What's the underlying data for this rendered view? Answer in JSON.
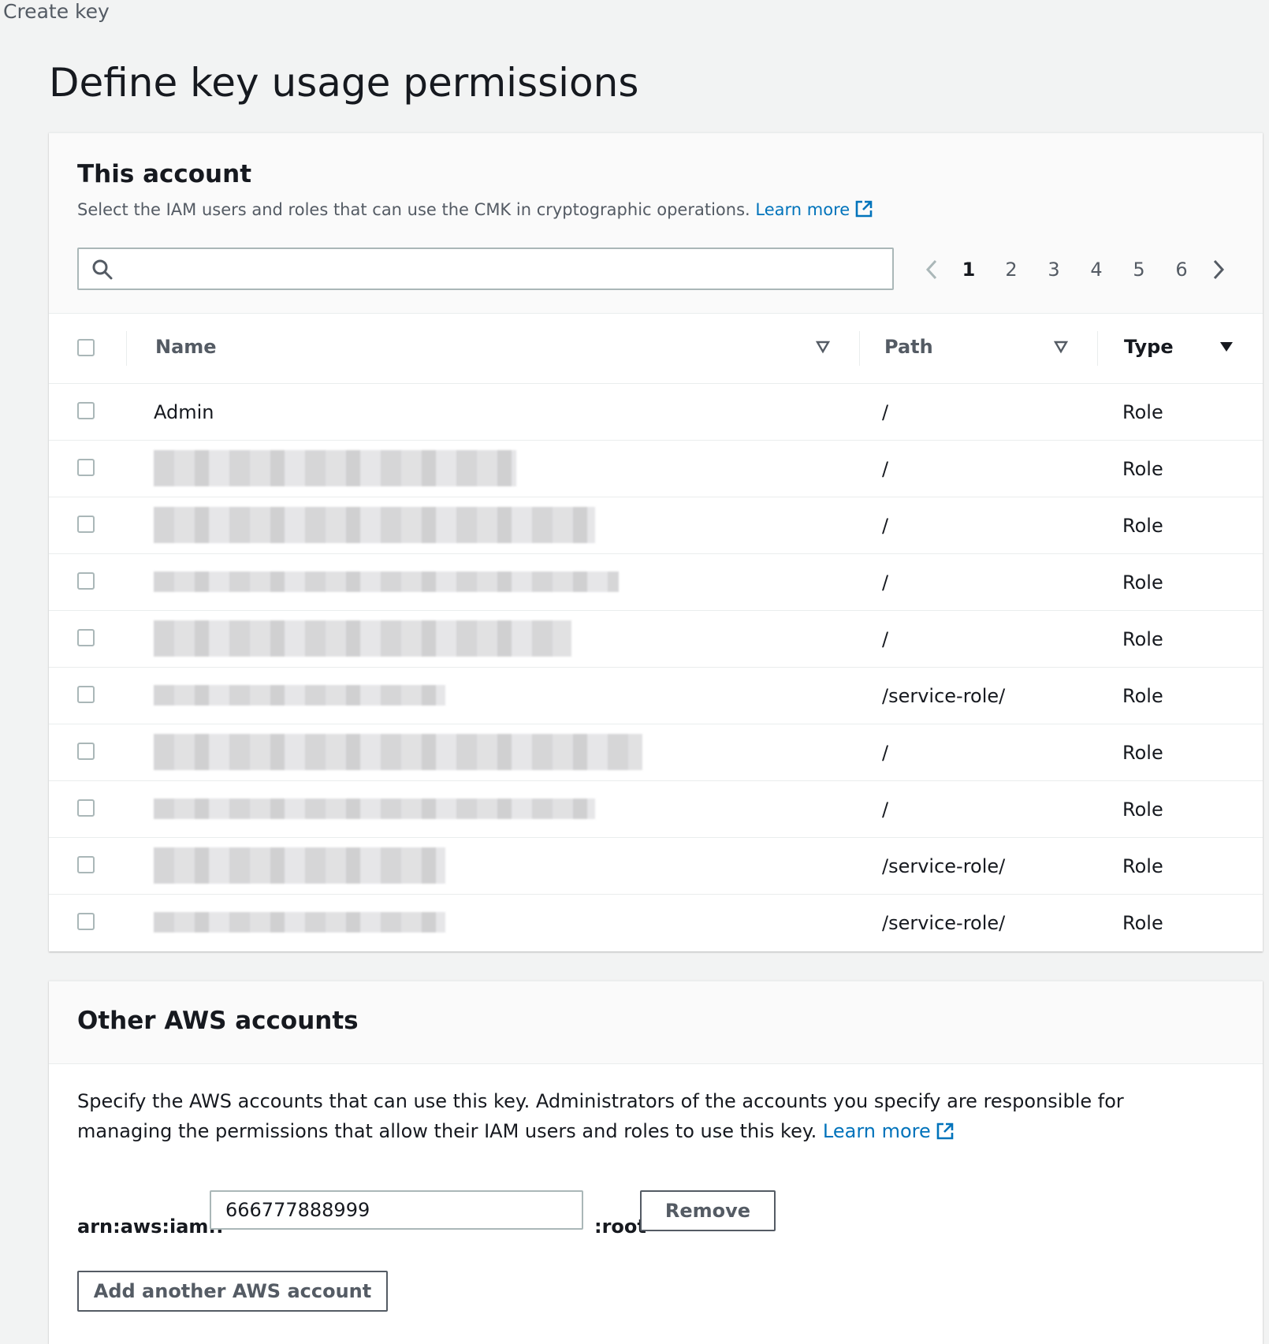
{
  "breadcrumb": "Create key",
  "page_title": "Define key usage permissions",
  "this_account": {
    "title": "This account",
    "description": "Select the IAM users and roles that can use the CMK in cryptographic operations.",
    "learn_more": "Learn more",
    "search_placeholder": "",
    "pagination": {
      "pages": [
        "1",
        "2",
        "3",
        "4",
        "5",
        "6"
      ],
      "current": "1"
    },
    "columns": {
      "name": "Name",
      "path": "Path",
      "type": "Type"
    },
    "rows": [
      {
        "name": "Admin",
        "path": "/",
        "type": "Role"
      },
      {
        "name": "",
        "path": "/",
        "type": "Role"
      },
      {
        "name": "",
        "path": "/",
        "type": "Role"
      },
      {
        "name": "",
        "path": "/",
        "type": "Role"
      },
      {
        "name": "",
        "path": "/",
        "type": "Role"
      },
      {
        "name": "",
        "path": "/service-role/",
        "type": "Role"
      },
      {
        "name": "",
        "path": "/",
        "type": "Role"
      },
      {
        "name": "",
        "path": "/",
        "type": "Role"
      },
      {
        "name": "",
        "path": "/service-role/",
        "type": "Role"
      },
      {
        "name": "",
        "path": "/service-role/",
        "type": "Role"
      }
    ]
  },
  "other_accounts": {
    "title": "Other AWS accounts",
    "description": "Specify the AWS accounts that can use this key. Administrators of the accounts you specify are responsible for managing the permissions that allow their IAM users and roles to use this key.",
    "learn_more": "Learn more",
    "arn_prefix": "arn:aws:iam::",
    "account_id": "666777888999",
    "arn_suffix": ":root",
    "remove_label": "Remove",
    "add_label": "Add another AWS account"
  },
  "colors": {
    "link": "#0073bb",
    "background": "#f2f3f3",
    "border": "#aab7b8"
  },
  "icons": [
    "search-icon",
    "external-link-icon",
    "chevron-left-icon",
    "chevron-right-icon",
    "filter-triangle-icon",
    "sort-descending-icon"
  ]
}
